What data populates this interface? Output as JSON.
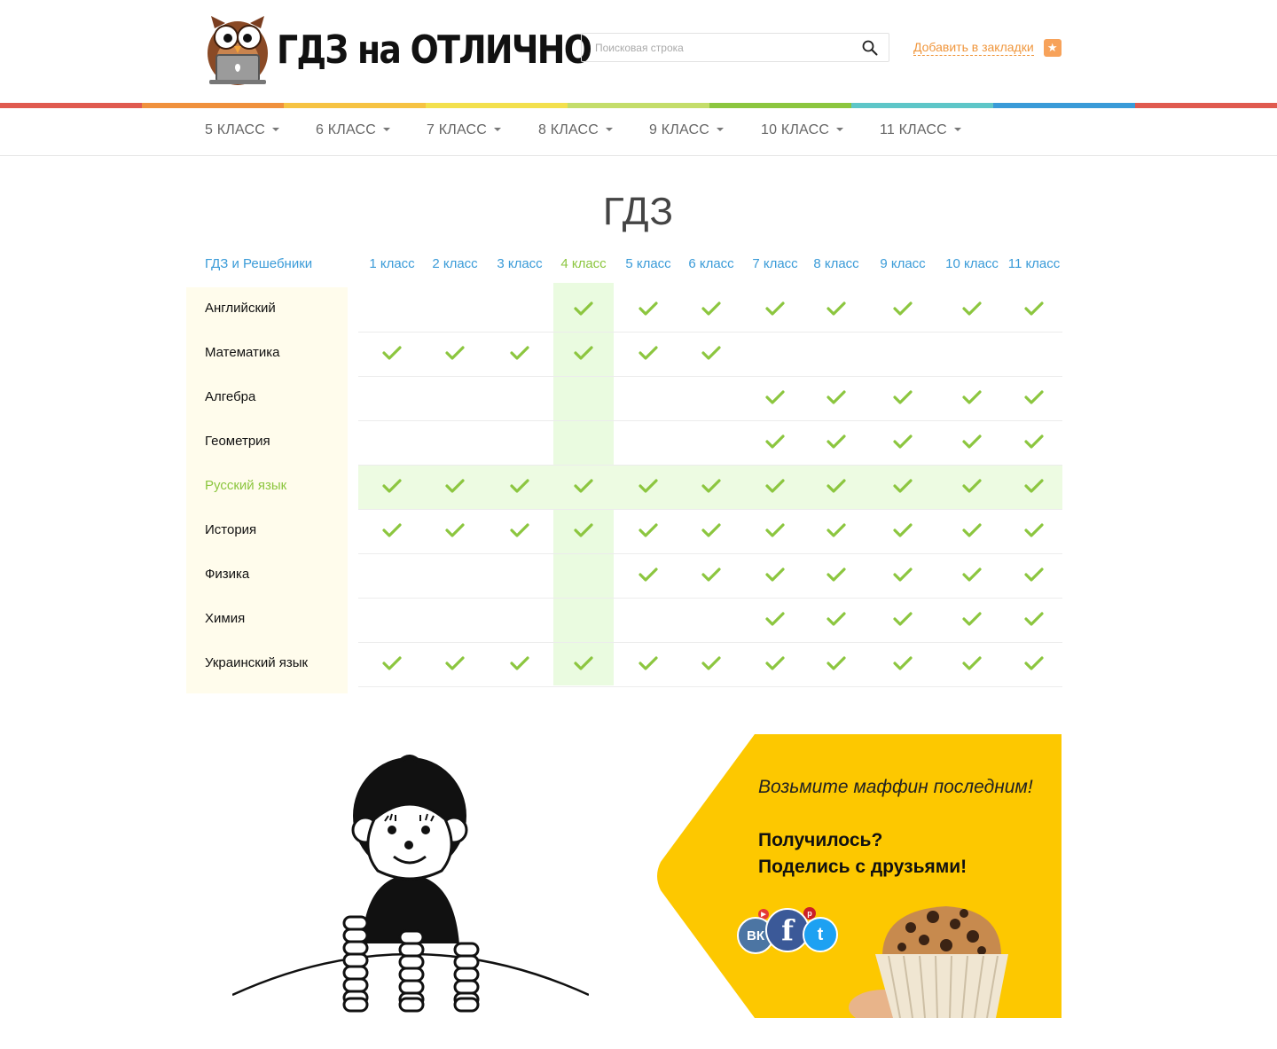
{
  "header": {
    "logo_text": "ГДЗ на ОТЛИЧНО",
    "search_placeholder": "Поисковая строка",
    "bookmark_label": "Добавить в закладки"
  },
  "colors": {
    "rainbow": [
      "#e05a4f",
      "#f0913d",
      "#f6c343",
      "#f3e04d",
      "#c4dd6a",
      "#8cc63f",
      "#5ec6c8",
      "#3a9bd8",
      "#e05a4f"
    ],
    "accent_blue": "#3a9bd8",
    "accent_green": "#8cc63f",
    "bookmark_orange": "#f0963c"
  },
  "nav": {
    "items": [
      {
        "label": "5 КЛАСС"
      },
      {
        "label": "6 КЛАСС"
      },
      {
        "label": "7 КЛАСС"
      },
      {
        "label": "8 КЛАСС"
      },
      {
        "label": "9 КЛАСС"
      },
      {
        "label": "10 КЛАСС"
      },
      {
        "label": "11 КЛАСС"
      }
    ]
  },
  "main": {
    "title": "ГДЗ",
    "corner_label": "ГДЗ и Решебники",
    "active_grade_index": 3,
    "active_subject_index": 4,
    "grades": [
      "1 класс",
      "2 класс",
      "3 класс",
      "4 класс",
      "5 класс",
      "6 класс",
      "7 класс",
      "8 класс",
      "9 класс",
      "10 класс",
      "11 класс"
    ],
    "subjects": [
      {
        "name": "Английский",
        "available": [
          false,
          false,
          false,
          true,
          true,
          true,
          true,
          true,
          true,
          true,
          true
        ]
      },
      {
        "name": "Математика",
        "available": [
          true,
          true,
          true,
          true,
          true,
          true,
          false,
          false,
          false,
          false,
          false
        ]
      },
      {
        "name": "Алгебра",
        "available": [
          false,
          false,
          false,
          false,
          false,
          false,
          true,
          true,
          true,
          true,
          true
        ]
      },
      {
        "name": "Геометрия",
        "available": [
          false,
          false,
          false,
          false,
          false,
          false,
          true,
          true,
          true,
          true,
          true
        ]
      },
      {
        "name": "Русский язык",
        "available": [
          true,
          true,
          true,
          true,
          true,
          true,
          true,
          true,
          true,
          true,
          true
        ]
      },
      {
        "name": "История",
        "available": [
          true,
          true,
          true,
          true,
          true,
          true,
          true,
          true,
          true,
          true,
          true
        ]
      },
      {
        "name": "Физика",
        "available": [
          false,
          false,
          false,
          false,
          true,
          true,
          true,
          true,
          true,
          true,
          true
        ]
      },
      {
        "name": "Химия",
        "available": [
          false,
          false,
          false,
          false,
          false,
          false,
          true,
          true,
          true,
          true,
          true
        ]
      },
      {
        "name": "Украинский язык",
        "available": [
          true,
          true,
          true,
          true,
          true,
          true,
          true,
          true,
          true,
          true,
          true
        ]
      }
    ]
  },
  "promo": {
    "tagline": "Возьмите маффин последним!",
    "line1": "Получилось?",
    "line2": "Поделись с друзьями!",
    "social": [
      {
        "name": "vk",
        "glyph": "ВК"
      },
      {
        "name": "facebook",
        "glyph": "f"
      },
      {
        "name": "twitter",
        "glyph": "t"
      }
    ]
  }
}
